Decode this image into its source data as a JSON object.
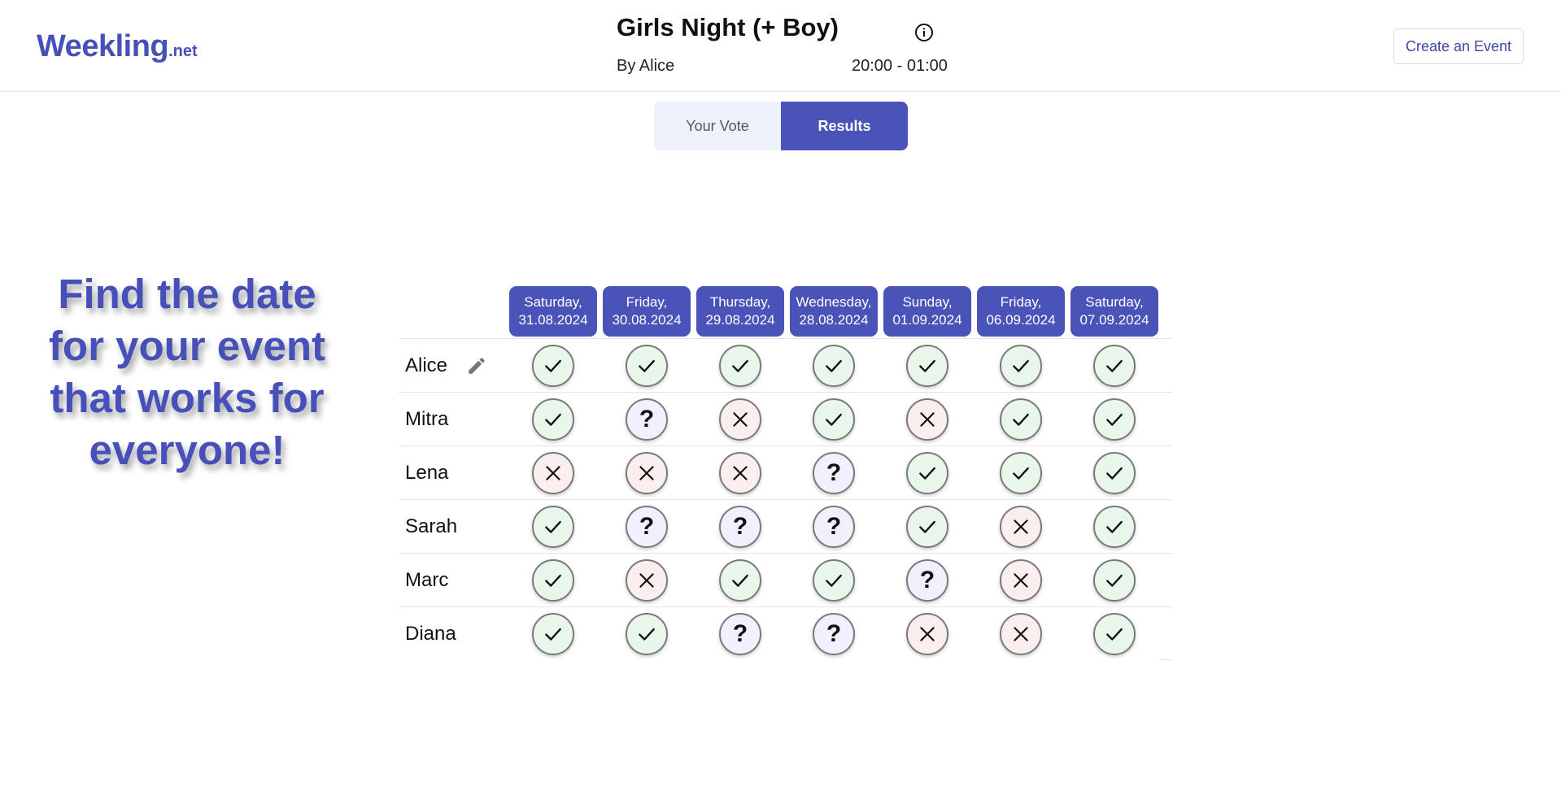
{
  "header": {
    "logo_main": "Weekling",
    "logo_suffix": ".net",
    "event_title": "Girls Night (+ Boy)",
    "author": "By Alice",
    "time": "20:00 - 01:00",
    "create_label": "Create an Event",
    "info_icon": "info-circle-icon"
  },
  "tabs": [
    {
      "label": "Your Vote",
      "active": false
    },
    {
      "label": "Results",
      "active": true
    }
  ],
  "hero_text": "Find the date for your event that works for everyone!",
  "dates": [
    {
      "day": "Saturday,",
      "date": "31.08.2024"
    },
    {
      "day": "Friday,",
      "date": "30.08.2024"
    },
    {
      "day": "Thursday,",
      "date": "29.08.2024"
    },
    {
      "day": "Wednesday,",
      "date": "28.08.2024"
    },
    {
      "day": "Sunday,",
      "date": "01.09.2024"
    },
    {
      "day": "Friday,",
      "date": "06.09.2024"
    },
    {
      "day": "Saturday,",
      "date": "07.09.2024"
    }
  ],
  "participants": [
    {
      "name": "Alice",
      "editable": true,
      "votes": [
        "yes",
        "yes",
        "yes",
        "yes",
        "yes",
        "yes",
        "yes"
      ]
    },
    {
      "name": "Mitra",
      "editable": false,
      "votes": [
        "yes",
        "maybe",
        "no",
        "yes",
        "no",
        "yes",
        "yes"
      ]
    },
    {
      "name": "Lena",
      "editable": false,
      "votes": [
        "no",
        "no",
        "no",
        "maybe",
        "yes",
        "yes",
        "yes"
      ]
    },
    {
      "name": "Sarah",
      "editable": false,
      "votes": [
        "yes",
        "maybe",
        "maybe",
        "maybe",
        "yes",
        "no",
        "yes"
      ]
    },
    {
      "name": "Marc",
      "editable": false,
      "votes": [
        "yes",
        "no",
        "yes",
        "yes",
        "maybe",
        "no",
        "yes"
      ]
    },
    {
      "name": "Diana",
      "editable": false,
      "votes": [
        "yes",
        "yes",
        "maybe",
        "maybe",
        "no",
        "no",
        "yes"
      ]
    }
  ],
  "icons": {
    "yes": "checkmark-icon",
    "no": "cross-icon",
    "maybe": "question-icon",
    "edit": "pencil-icon"
  },
  "colors": {
    "brand": "#4650b8",
    "yes_bg": "#e9f6ea",
    "no_bg": "#fbeeee",
    "maybe_bg": "#f2efff"
  }
}
